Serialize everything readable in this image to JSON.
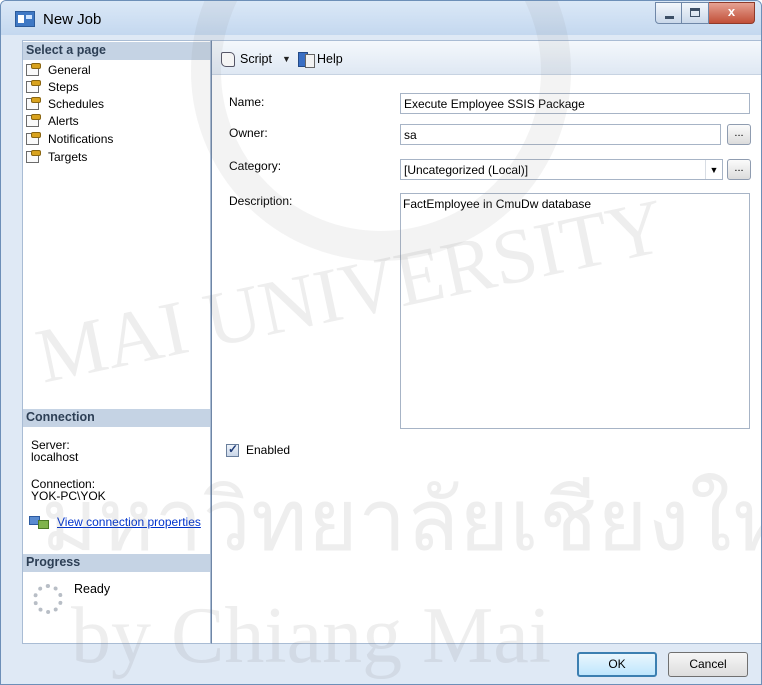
{
  "window": {
    "title": "New Job",
    "close_glyph": "x"
  },
  "left_pane": {
    "select_page_header": "Select a page",
    "pages": [
      "General",
      "Steps",
      "Schedules",
      "Alerts",
      "Notifications",
      "Targets"
    ],
    "connection_header": "Connection",
    "server_label": "Server:",
    "server_value": "localhost",
    "connection_label": "Connection:",
    "connection_value": "YOK-PC\\YOK",
    "view_connection_link": "View connection properties",
    "progress_header": "Progress",
    "progress_status": "Ready"
  },
  "toolbar": {
    "script_label": "Script",
    "script_dropdown": "▼",
    "help_label": "Help"
  },
  "form": {
    "name_label": "Name:",
    "name_value": "Execute Employee SSIS Package",
    "owner_label": "Owner:",
    "owner_value": "sa",
    "category_label": "Category:",
    "category_value": "[Uncategorized (Local)]",
    "category_arrow": "▼",
    "description_label": "Description:",
    "description_value": "FactEmployee in CmuDw database",
    "browse_label": "...",
    "enabled_label": "Enabled",
    "enabled_checked": "✓"
  },
  "buttons": {
    "ok_label": "OK",
    "cancel_label": "Cancel"
  },
  "watermark": {
    "line1": "MAI UNIVERSITY",
    "line2": "มหาวิทยาลัยเชียงใหม่",
    "line3": "by Chiang Mai"
  }
}
